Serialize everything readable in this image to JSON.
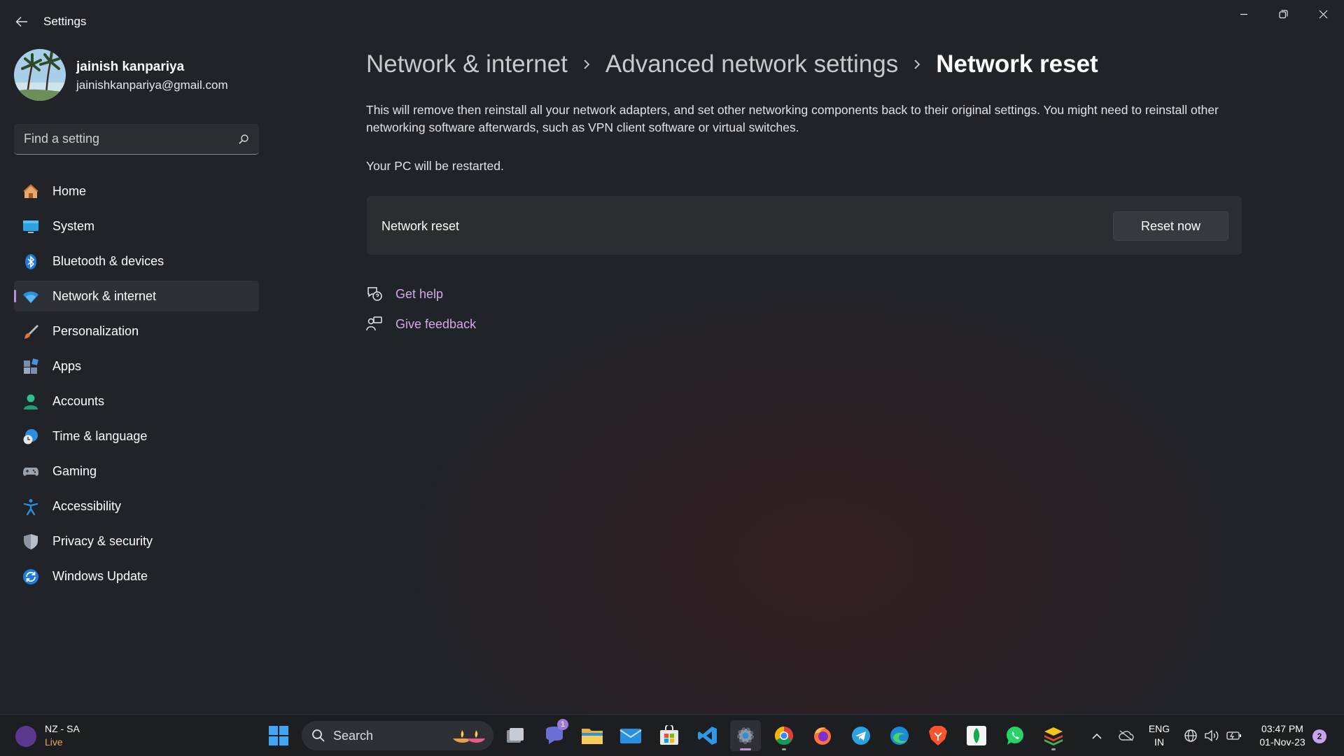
{
  "window": {
    "title": "Settings",
    "controls": {
      "minimize_icon": "minimize-icon",
      "restore_icon": "restore-icon",
      "close_icon": "close-icon"
    }
  },
  "profile": {
    "name": "jainish kanpariya",
    "email": "jainishkanpariya@gmail.com"
  },
  "search": {
    "placeholder": "Find a setting"
  },
  "sidebar": {
    "items": [
      {
        "label": "Home",
        "icon": "home-icon",
        "active": false
      },
      {
        "label": "System",
        "icon": "monitor-icon",
        "active": false
      },
      {
        "label": "Bluetooth & devices",
        "icon": "bluetooth-icon",
        "active": false
      },
      {
        "label": "Network & internet",
        "icon": "wifi-icon",
        "active": true
      },
      {
        "label": "Personalization",
        "icon": "brush-icon",
        "active": false
      },
      {
        "label": "Apps",
        "icon": "apps-icon",
        "active": false
      },
      {
        "label": "Accounts",
        "icon": "person-icon",
        "active": false
      },
      {
        "label": "Time & language",
        "icon": "globe-clock-icon",
        "active": false
      },
      {
        "label": "Gaming",
        "icon": "gamepad-icon",
        "active": false
      },
      {
        "label": "Accessibility",
        "icon": "accessibility-icon",
        "active": false
      },
      {
        "label": "Privacy & security",
        "icon": "shield-icon",
        "active": false
      },
      {
        "label": "Windows Update",
        "icon": "update-icon",
        "active": false
      }
    ]
  },
  "breadcrumb": {
    "items": [
      "Network & internet",
      "Advanced network settings",
      "Network reset"
    ]
  },
  "main": {
    "description": "This will remove then reinstall all your network adapters, and set other networking components back to their original settings. You might need to reinstall other networking software afterwards, such as VPN client software or virtual switches.",
    "restart_note": "Your PC will be restarted.",
    "card_label": "Network reset",
    "reset_button": "Reset now",
    "links": [
      {
        "label": "Get help",
        "icon": "help-chat-icon"
      },
      {
        "label": "Give feedback",
        "icon": "feedback-icon"
      }
    ]
  },
  "colors": {
    "accent": "#c58bd8",
    "link": "#d4a9e6",
    "background": "#202328",
    "card": "#2b2d31"
  },
  "taskbar": {
    "weather": {
      "title": "NZ - SA",
      "subtitle": "Live"
    },
    "search_label": "Search",
    "apps": [
      {
        "name": "task-view",
        "badge": ""
      },
      {
        "name": "teams-chat",
        "badge": "1"
      },
      {
        "name": "file-explorer",
        "badge": ""
      },
      {
        "name": "mail",
        "badge": ""
      },
      {
        "name": "microsoft-store",
        "badge": ""
      },
      {
        "name": "vs-code",
        "badge": ""
      },
      {
        "name": "settings",
        "badge": ""
      },
      {
        "name": "chrome",
        "badge": ""
      },
      {
        "name": "firefox",
        "badge": ""
      },
      {
        "name": "telegram",
        "badge": ""
      },
      {
        "name": "edge",
        "badge": ""
      },
      {
        "name": "brave",
        "badge": ""
      },
      {
        "name": "mongodb-compass",
        "badge": ""
      },
      {
        "name": "whatsapp",
        "badge": ""
      },
      {
        "name": "bluestacks",
        "badge": ""
      }
    ],
    "language": {
      "line1": "ENG",
      "line2": "IN"
    },
    "clock": {
      "time": "03:47 PM",
      "date": "01-Nov-23"
    },
    "notifications": "2"
  }
}
